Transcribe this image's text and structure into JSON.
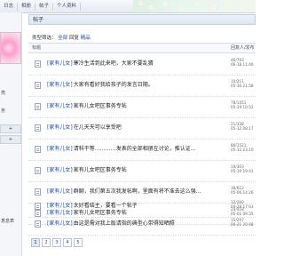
{
  "topnav": [
    "日志",
    "相册",
    "帖子",
    "个人资料"
  ],
  "sidebar": {
    "label_a": "亮",
    "label_b": "务",
    "btn_1": "+",
    "btn_2": "+",
    "label_c": "意息表"
  },
  "page_title": "帖子",
  "filter": {
    "label": "类型筛选：",
    "opt1": "全部",
    "opt2": "回复",
    "opt3": "精品"
  },
  "table_head": {
    "title": "标题",
    "meta": "回复人/发布"
  },
  "rows": [
    {
      "tag": "[家有儿女]",
      "title": "寒冷生活到此来吧，大家不要乱猜",
      "meta1": "46/793",
      "meta2": "06-18 11:40"
    },
    {
      "tag": "[家有儿女]",
      "title": "大家有看好我给孩子的发言日期。",
      "meta1": "10/211",
      "meta2": "05-30 21:58"
    },
    {
      "tag": "[家有儿女]",
      "title": "家有儿女吧区事务专帖",
      "meta1": "78/1451",
      "meta2": "05-29 10:52"
    },
    {
      "tag": "[家有儿女]",
      "title": "在儿天天可以享受吧",
      "meta1": "21/338",
      "meta2": "05-12 08:17"
    },
    {
      "tag": "[家有儿女]",
      "title": "请科干等…………发表的全部相册左讨论，推认证…",
      "meta1": "86/1521",
      "meta2": "05-11 23:10"
    },
    {
      "tag": "[家有儿女]",
      "title": "家有儿女吧区事务专帖",
      "meta1": "19/303",
      "meta2": "05-10 19:41"
    },
    {
      "tag": "[家有儿女]",
      "title": "群聊，我们第五次我发帖啊，里面有将不准去这么强…",
      "meta1": "38/612",
      "meta2": "05-06 14:26"
    },
    {
      "tag": "[家有儿女]",
      "title": "家有儿女吧区事务专帖",
      "meta1": "24/418",
      "meta2": "05-02 09:35"
    },
    {
      "tag": "[家有儿女]",
      "title": "太好看结主，要看一个帖子",
      "meta1": "12/260",
      "meta2": "04-28 17:03"
    },
    {
      "tag": "[家有儿女]",
      "title": "由这是需对我上版请指的典型心带得知晒照",
      "meta1": "15/297",
      "meta2": "04-21 20:48"
    }
  ],
  "pager": [
    "1",
    "2",
    "3",
    "4",
    "5"
  ]
}
